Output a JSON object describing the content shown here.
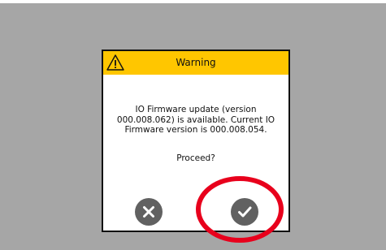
{
  "dialog": {
    "title": "Warning",
    "message": "IO Firmware update (version 000.008.062) is available. Current IO Firmware version is 000.008.054.",
    "question": "Proceed?",
    "icons": {
      "header": "warning-icon",
      "cancel": "close-icon",
      "confirm": "check-icon"
    }
  },
  "colors": {
    "backdrop": "#a6a6a6",
    "header": "#ffc600",
    "button": "#616161",
    "annotation": "#e8001c"
  }
}
